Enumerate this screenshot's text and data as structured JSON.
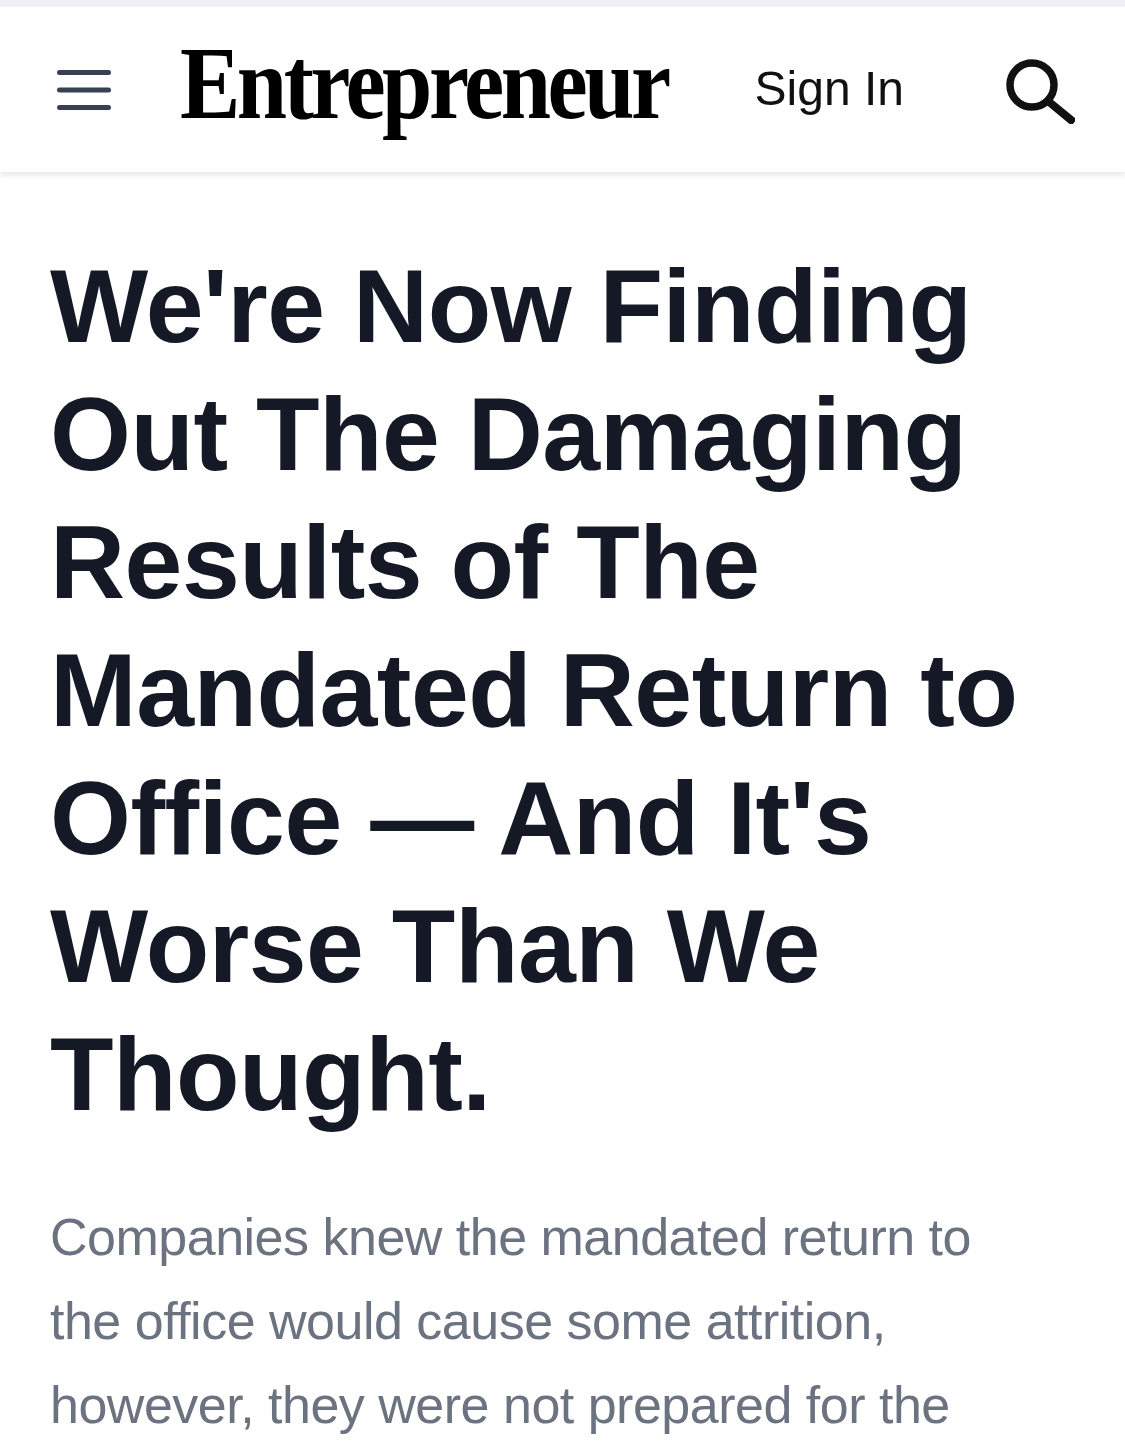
{
  "header": {
    "logo": "Entrepreneur",
    "sign_in": "Sign In"
  },
  "article": {
    "headline": "We're Now Finding Out The Damaging Results of The Mandated Return to Office — And It's Worse Than We Thought.",
    "dek": "Companies knew the mandated return to the office would cause some attrition, however, they were not prepared for the"
  }
}
